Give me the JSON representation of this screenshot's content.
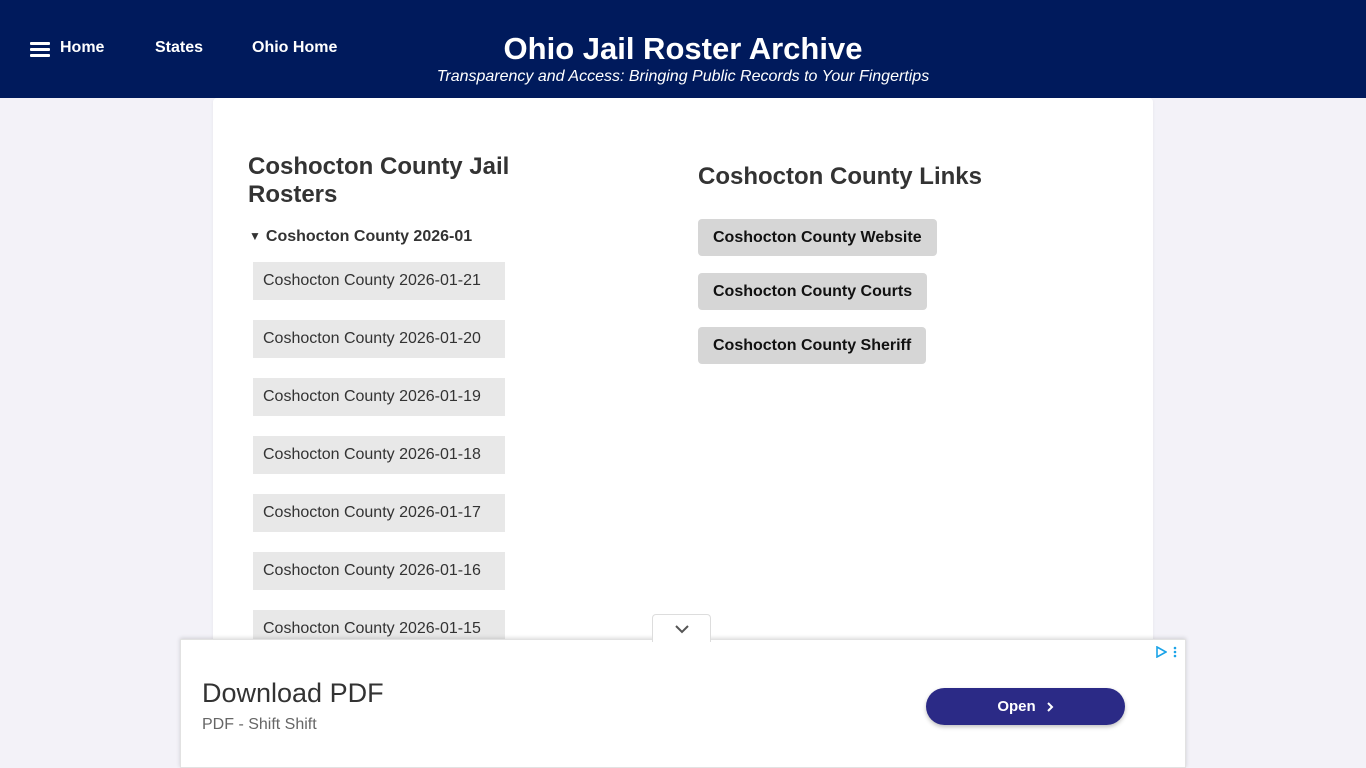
{
  "nav": {
    "home": "Home",
    "states": "States",
    "ohio_home": "Ohio Home"
  },
  "header": {
    "title": "Ohio Jail Roster Archive",
    "tagline": "Transparency and Access: Bringing Public Records to Your Fingertips"
  },
  "rosters": {
    "heading_line1": "Coshocton County Jail",
    "heading_line2": "Rosters",
    "month_label": "Coshocton County 2026-01",
    "items": [
      "Coshocton County 2026-01-21",
      "Coshocton County 2026-01-20",
      "Coshocton County 2026-01-19",
      "Coshocton County 2026-01-18",
      "Coshocton County 2026-01-17",
      "Coshocton County 2026-01-16",
      "Coshocton County 2026-01-15"
    ]
  },
  "links": {
    "heading": "Coshocton County Links",
    "items": [
      "Coshocton County Website",
      "Coshocton County Courts",
      "Coshocton County Sheriff"
    ]
  },
  "ad": {
    "title": "Download PDF",
    "subtitle": "PDF - Shift Shift",
    "button": "Open"
  },
  "colors": {
    "header_bg": "#001a5c",
    "ad_button": "#2b2a86",
    "adchoices": "#1aa3e8"
  }
}
